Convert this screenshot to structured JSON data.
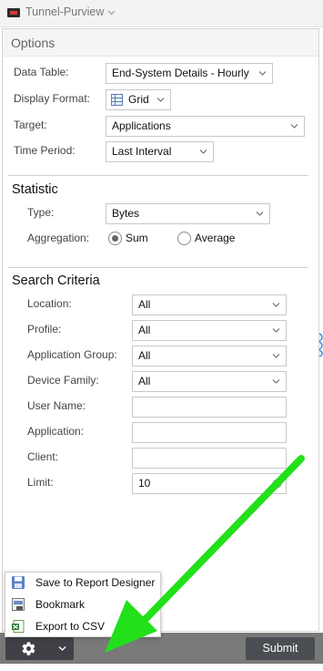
{
  "header": {
    "title": "Tunnel-Purview"
  },
  "options": {
    "title": "Options",
    "data_table": {
      "label": "Data Table:",
      "value": "End-System Details - Hourly"
    },
    "display_format": {
      "label": "Display Format:",
      "value": "Grid"
    },
    "target": {
      "label": "Target:",
      "value": "Applications"
    },
    "time_period": {
      "label": "Time Period:",
      "value": "Last Interval"
    }
  },
  "statistic": {
    "title": "Statistic",
    "type": {
      "label": "Type:",
      "value": "Bytes"
    },
    "aggregation": {
      "label": "Aggregation:",
      "sum": "Sum",
      "average": "Average",
      "selected": "Sum"
    }
  },
  "search": {
    "title": "Search Criteria",
    "location": {
      "label": "Location:",
      "value": "All"
    },
    "profile": {
      "label": "Profile:",
      "value": "All"
    },
    "application_group": {
      "label": "Application Group:",
      "value": "All"
    },
    "device_family": {
      "label": "Device Family:",
      "value": "All"
    },
    "user_name": {
      "label": "User Name:",
      "value": ""
    },
    "application": {
      "label": "Application:",
      "value": ""
    },
    "client": {
      "label": "Client:",
      "value": ""
    },
    "limit": {
      "label": "Limit:",
      "value": "10"
    }
  },
  "menu": {
    "items": [
      {
        "label": "Save to Report Designer",
        "icon": "save-icon"
      },
      {
        "label": "Bookmark",
        "icon": "bookmark-icon"
      },
      {
        "label": "Export to CSV",
        "icon": "csv-export-icon"
      }
    ]
  },
  "footer": {
    "submit_label": "Submit"
  },
  "colors": {
    "bottom_bar": "#797979",
    "button_dark": "#3f4147",
    "annotation_arrow": "#22e01a",
    "side_handle": "#2f7fd0"
  }
}
